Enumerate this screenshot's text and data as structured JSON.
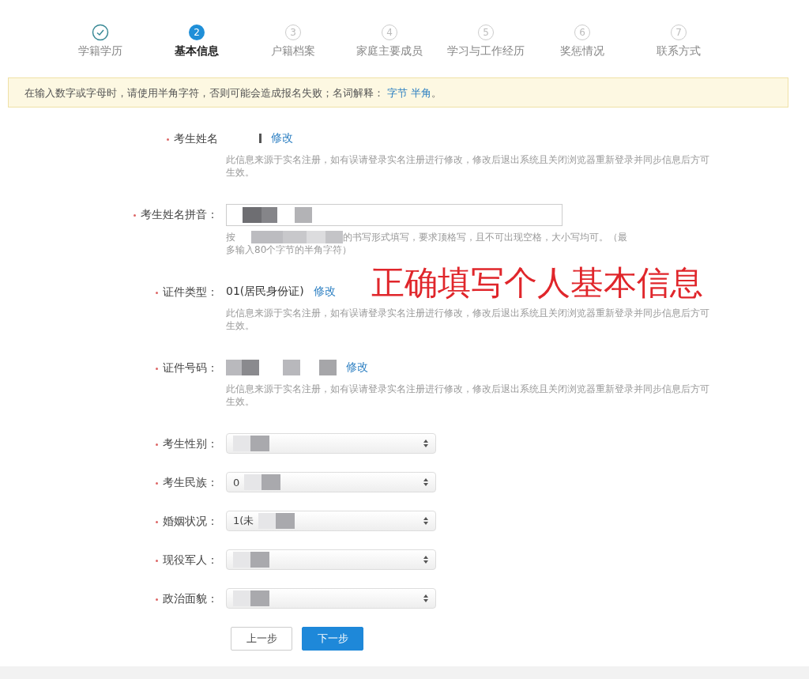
{
  "steps": [
    {
      "label": "学籍学历",
      "completed": true,
      "selected": false
    },
    {
      "number": "2",
      "label": "基本信息",
      "completed": false,
      "selected": true
    },
    {
      "number": "3",
      "label": "户籍档案",
      "completed": false,
      "selected": false
    },
    {
      "number": "4",
      "label": "家庭主要成员",
      "completed": false,
      "selected": false
    },
    {
      "number": "5",
      "label": "学习与工作经历",
      "completed": false,
      "selected": false
    },
    {
      "number": "6",
      "label": "奖惩情况",
      "completed": false,
      "selected": false
    },
    {
      "number": "7",
      "label": "联系方式",
      "completed": false,
      "selected": false
    }
  ],
  "notice": {
    "text": "在输入数字或字母时，请使用半角字符，否则可能会造成报名失败；名词解释：",
    "links": [
      "字节",
      "半角"
    ],
    "end": "。"
  },
  "fields": [
    {
      "kind": "readonly",
      "label": "考生姓名",
      "redacted": true,
      "edit_link": "修改",
      "help": [
        "此信息来源于实名注册，如有误请登录实名注册进行修改，修改后退出系统且关闭浏览器重新登录并同步信息后方可生效。"
      ]
    },
    {
      "kind": "input",
      "label": "考生姓名拼音：",
      "redacted": true,
      "help": [
        "按",
        "的书写形式填写，要求顶格写，且不可出现空格，大小写均可。（最",
        "多输入80个字节的半角字符）"
      ]
    },
    {
      "kind": "readonly",
      "label": "证件类型：",
      "value": "01(居民身份证)",
      "edit_link": "修改",
      "help": [
        "此信息来源于实名注册，如有误请登录实名注册进行修改，修改后退出系统且关闭浏览器重新登录并同步信息后方可生效。"
      ]
    },
    {
      "kind": "readonly",
      "label": "证件号码：",
      "redacted": true,
      "edit_link": "修改",
      "help": [
        "此信息来源于实名注册，如有误请登录实名注册进行修改，修改后退出系统且关闭浏览器重新登录并同步信息后方可生效。"
      ]
    },
    {
      "kind": "select",
      "label": "考生性别：",
      "redacted": true
    },
    {
      "kind": "select",
      "label": "考生民族：",
      "value": "0",
      "redacted": true
    },
    {
      "kind": "select",
      "label": "婚姻状况：",
      "value": "1(未",
      "redacted": true
    },
    {
      "kind": "select",
      "label": "现役军人：",
      "redacted": true
    },
    {
      "kind": "select",
      "label": "政治面貌：",
      "redacted": true
    }
  ],
  "buttons": [
    {
      "label": "上一步",
      "primary": false
    },
    {
      "label": "下一步",
      "primary": true
    }
  ],
  "annotation": "正确填写个人基本信息"
}
